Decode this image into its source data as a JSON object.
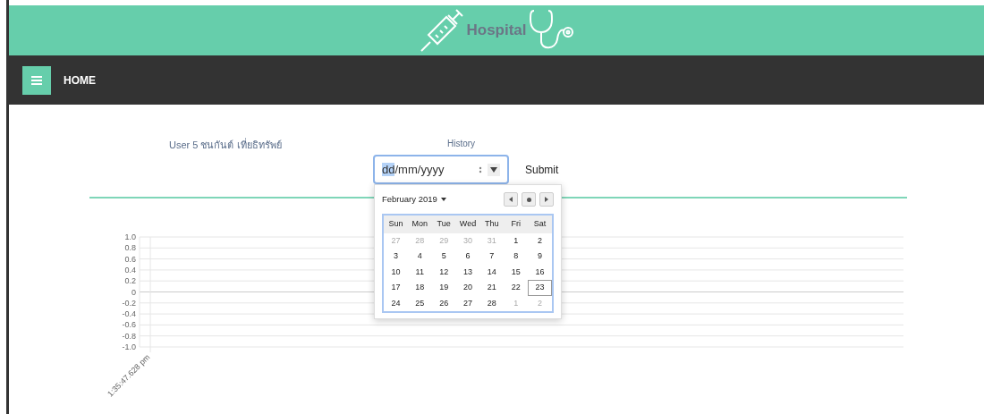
{
  "header": {
    "title": "Hospital"
  },
  "navbar": {
    "items": [
      {
        "label": "HOME"
      }
    ]
  },
  "user": {
    "label": "User 5 ชนกันต์ เที่ยธิทรัพย์"
  },
  "history": {
    "label": "History",
    "date_field": {
      "segments": [
        {
          "text": "dd",
          "selected": true
        },
        {
          "text": "/",
          "selected": false
        },
        {
          "text": "mm",
          "selected": false
        },
        {
          "text": "/",
          "selected": false
        },
        {
          "text": "yyyy",
          "selected": false
        }
      ]
    },
    "submit": "Submit"
  },
  "datepicker": {
    "month_label": "February 2019",
    "weekdays": [
      "Sun",
      "Mon",
      "Tue",
      "Wed",
      "Thu",
      "Fri",
      "Sat"
    ],
    "weeks": [
      [
        {
          "day": "27",
          "muted": true,
          "selected": false
        },
        {
          "day": "28",
          "muted": true,
          "selected": false
        },
        {
          "day": "29",
          "muted": true,
          "selected": false
        },
        {
          "day": "30",
          "muted": true,
          "selected": false
        },
        {
          "day": "31",
          "muted": true,
          "selected": false
        },
        {
          "day": "1",
          "muted": false,
          "selected": false
        },
        {
          "day": "2",
          "muted": false,
          "selected": false
        }
      ],
      [
        {
          "day": "3",
          "muted": false,
          "selected": false
        },
        {
          "day": "4",
          "muted": false,
          "selected": false
        },
        {
          "day": "5",
          "muted": false,
          "selected": false
        },
        {
          "day": "6",
          "muted": false,
          "selected": false
        },
        {
          "day": "7",
          "muted": false,
          "selected": false
        },
        {
          "day": "8",
          "muted": false,
          "selected": false
        },
        {
          "day": "9",
          "muted": false,
          "selected": false
        }
      ],
      [
        {
          "day": "10",
          "muted": false,
          "selected": false
        },
        {
          "day": "11",
          "muted": false,
          "selected": false
        },
        {
          "day": "12",
          "muted": false,
          "selected": false
        },
        {
          "day": "13",
          "muted": false,
          "selected": false
        },
        {
          "day": "14",
          "muted": false,
          "selected": false
        },
        {
          "day": "15",
          "muted": false,
          "selected": false
        },
        {
          "day": "16",
          "muted": false,
          "selected": false
        }
      ],
      [
        {
          "day": "17",
          "muted": false,
          "selected": false
        },
        {
          "day": "18",
          "muted": false,
          "selected": false
        },
        {
          "day": "19",
          "muted": false,
          "selected": false
        },
        {
          "day": "20",
          "muted": false,
          "selected": false
        },
        {
          "day": "21",
          "muted": false,
          "selected": false
        },
        {
          "day": "22",
          "muted": false,
          "selected": false
        },
        {
          "day": "23",
          "muted": false,
          "selected": true
        }
      ],
      [
        {
          "day": "24",
          "muted": false,
          "selected": false
        },
        {
          "day": "25",
          "muted": false,
          "selected": false
        },
        {
          "day": "26",
          "muted": false,
          "selected": false
        },
        {
          "day": "27",
          "muted": false,
          "selected": false
        },
        {
          "day": "28",
          "muted": false,
          "selected": false
        },
        {
          "day": "1",
          "muted": true,
          "selected": false
        },
        {
          "day": "2",
          "muted": true,
          "selected": false
        }
      ]
    ]
  },
  "chart": {
    "chart_data": {
      "type": "line",
      "grid": true,
      "categories": [
        "1:35:47.628 pm"
      ],
      "ylim": [
        -1,
        1
      ],
      "yticks": [
        {
          "value": 1,
          "label": "1.0"
        },
        {
          "value": 0.8,
          "label": "0.8"
        },
        {
          "value": 0.6,
          "label": "0.6"
        },
        {
          "value": 0.4,
          "label": "0.4"
        },
        {
          "value": 0.2,
          "label": "0.2"
        },
        {
          "value": 0,
          "label": "0"
        },
        {
          "value": -0.2,
          "label": "-0.2"
        },
        {
          "value": -0.4,
          "label": "-0.4"
        },
        {
          "value": -0.6,
          "label": "-0.6"
        },
        {
          "value": -0.8,
          "label": "-0.8"
        },
        {
          "value": -1,
          "label": "-1.0"
        }
      ],
      "series": [
        {
          "values": [
            null
          ]
        }
      ]
    }
  }
}
